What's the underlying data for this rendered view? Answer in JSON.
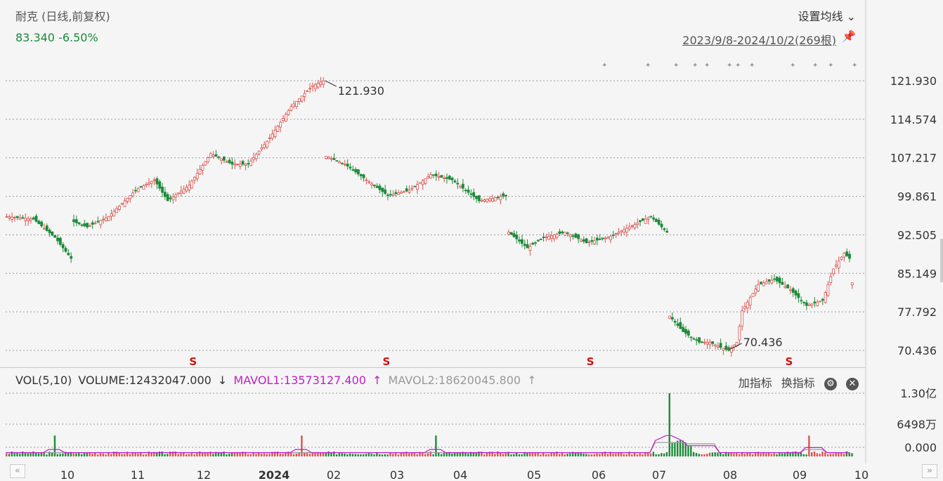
{
  "header": {
    "title": "耐克 (日线,前复权)",
    "price_change": "83.340 -6.50%",
    "set_ma_label": "设置均线 ⌄",
    "range_label": "2023/9/8-2024/10/2(269根)",
    "pin_icon": "pin-icon"
  },
  "volume_header": {
    "vol_label": "VOL(5,10)",
    "volume": "VOLUME:12432047.000",
    "volume_arrow": "↓",
    "mavol1": "MAVOL1:13573127.400",
    "mavol1_arrow": "↑",
    "mavol2": "MAVOL2:18620045.800",
    "mavol2_arrow": "↑",
    "add_indicator": "加指标",
    "switch_indicator": "换指标",
    "settings_icon": "gear-icon",
    "close_icon": "close-icon"
  },
  "colors": {
    "up": "#d9534f",
    "down": "#1e8a3a",
    "mavol1": "#c21ec6",
    "mavol2": "#999999",
    "grid": "#999999"
  },
  "chart_data": {
    "type": "candlestick",
    "price_axis_ticks": [
      "121.930",
      "114.574",
      "107.217",
      "99.861",
      "92.505",
      "85.149",
      "77.792",
      "70.436"
    ],
    "price_ylim": [
      70.436,
      121.93
    ],
    "volume_axis_ticks": [
      "1.30亿",
      "6498万",
      "0.000"
    ],
    "x_tick_labels": [
      "10",
      "11",
      "12",
      "2024",
      "02",
      "03",
      "04",
      "05",
      "06",
      "07",
      "08",
      "09",
      "10"
    ],
    "annotations": {
      "high": "121.930",
      "low": "70.436"
    },
    "event_marker": "S",
    "price_path": [
      {
        "i": 0,
        "v": 96
      },
      {
        "i": 10,
        "v": 95.5
      },
      {
        "i": 18,
        "v": 92
      },
      {
        "i": 24,
        "v": 88
      },
      {
        "i": 25,
        "v": 95
      },
      {
        "i": 30,
        "v": 94
      },
      {
        "i": 38,
        "v": 96
      },
      {
        "i": 48,
        "v": 101
      },
      {
        "i": 55,
        "v": 103
      },
      {
        "i": 60,
        "v": 99
      },
      {
        "i": 68,
        "v": 102
      },
      {
        "i": 76,
        "v": 108
      },
      {
        "i": 84,
        "v": 106
      },
      {
        "i": 90,
        "v": 106
      },
      {
        "i": 98,
        "v": 111
      },
      {
        "i": 106,
        "v": 117
      },
      {
        "i": 114,
        "v": 121
      },
      {
        "i": 118,
        "v": 121.93
      },
      {
        "i": 119,
        "v": 107.5
      },
      {
        "i": 126,
        "v": 106
      },
      {
        "i": 134,
        "v": 103
      },
      {
        "i": 142,
        "v": 100
      },
      {
        "i": 150,
        "v": 101
      },
      {
        "i": 158,
        "v": 104
      },
      {
        "i": 166,
        "v": 103
      },
      {
        "i": 176,
        "v": 99
      },
      {
        "i": 186,
        "v": 100
      },
      {
        "i": 187,
        "v": 93
      },
      {
        "i": 194,
        "v": 90
      },
      {
        "i": 200,
        "v": 92
      },
      {
        "i": 208,
        "v": 93
      },
      {
        "i": 216,
        "v": 91
      },
      {
        "i": 224,
        "v": 92
      },
      {
        "i": 232,
        "v": 94
      },
      {
        "i": 240,
        "v": 96
      },
      {
        "i": 246,
        "v": 93
      },
      {
        "i": 247,
        "v": 77
      },
      {
        "i": 252,
        "v": 74
      },
      {
        "i": 258,
        "v": 72
      },
      {
        "i": 262,
        "v": 72
      },
      {
        "i": 266,
        "v": 71
      },
      {
        "i": 269,
        "v": 70.44
      },
      {
        "i": 272,
        "v": 72
      },
      {
        "i": 274,
        "v": 78
      },
      {
        "i": 280,
        "v": 83
      },
      {
        "i": 286,
        "v": 84
      },
      {
        "i": 292,
        "v": 82
      },
      {
        "i": 298,
        "v": 79
      },
      {
        "i": 304,
        "v": 80
      },
      {
        "i": 308,
        "v": 86
      },
      {
        "i": 312,
        "v": 89
      },
      {
        "i": 314,
        "v": 88
      },
      {
        "i": 315,
        "v": 83.34
      }
    ],
    "volume_spike": {
      "i": 247,
      "value_label": "1.30亿"
    }
  }
}
